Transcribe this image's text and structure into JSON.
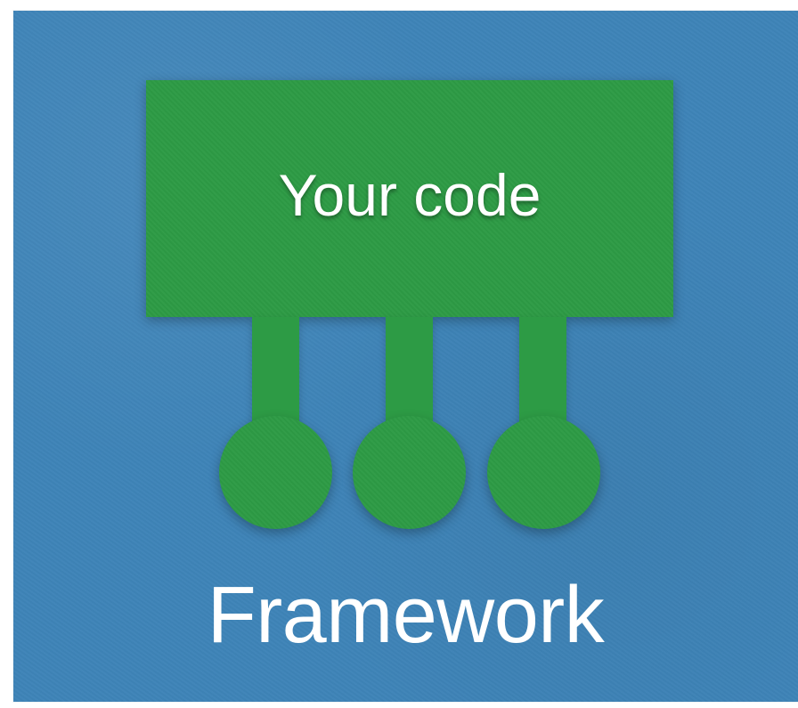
{
  "slide": {
    "code_label": "Your code",
    "framework_label": "Framework",
    "colors": {
      "background": "#3e84b8",
      "component": "#2d9b45",
      "text": "#ffffff"
    }
  }
}
